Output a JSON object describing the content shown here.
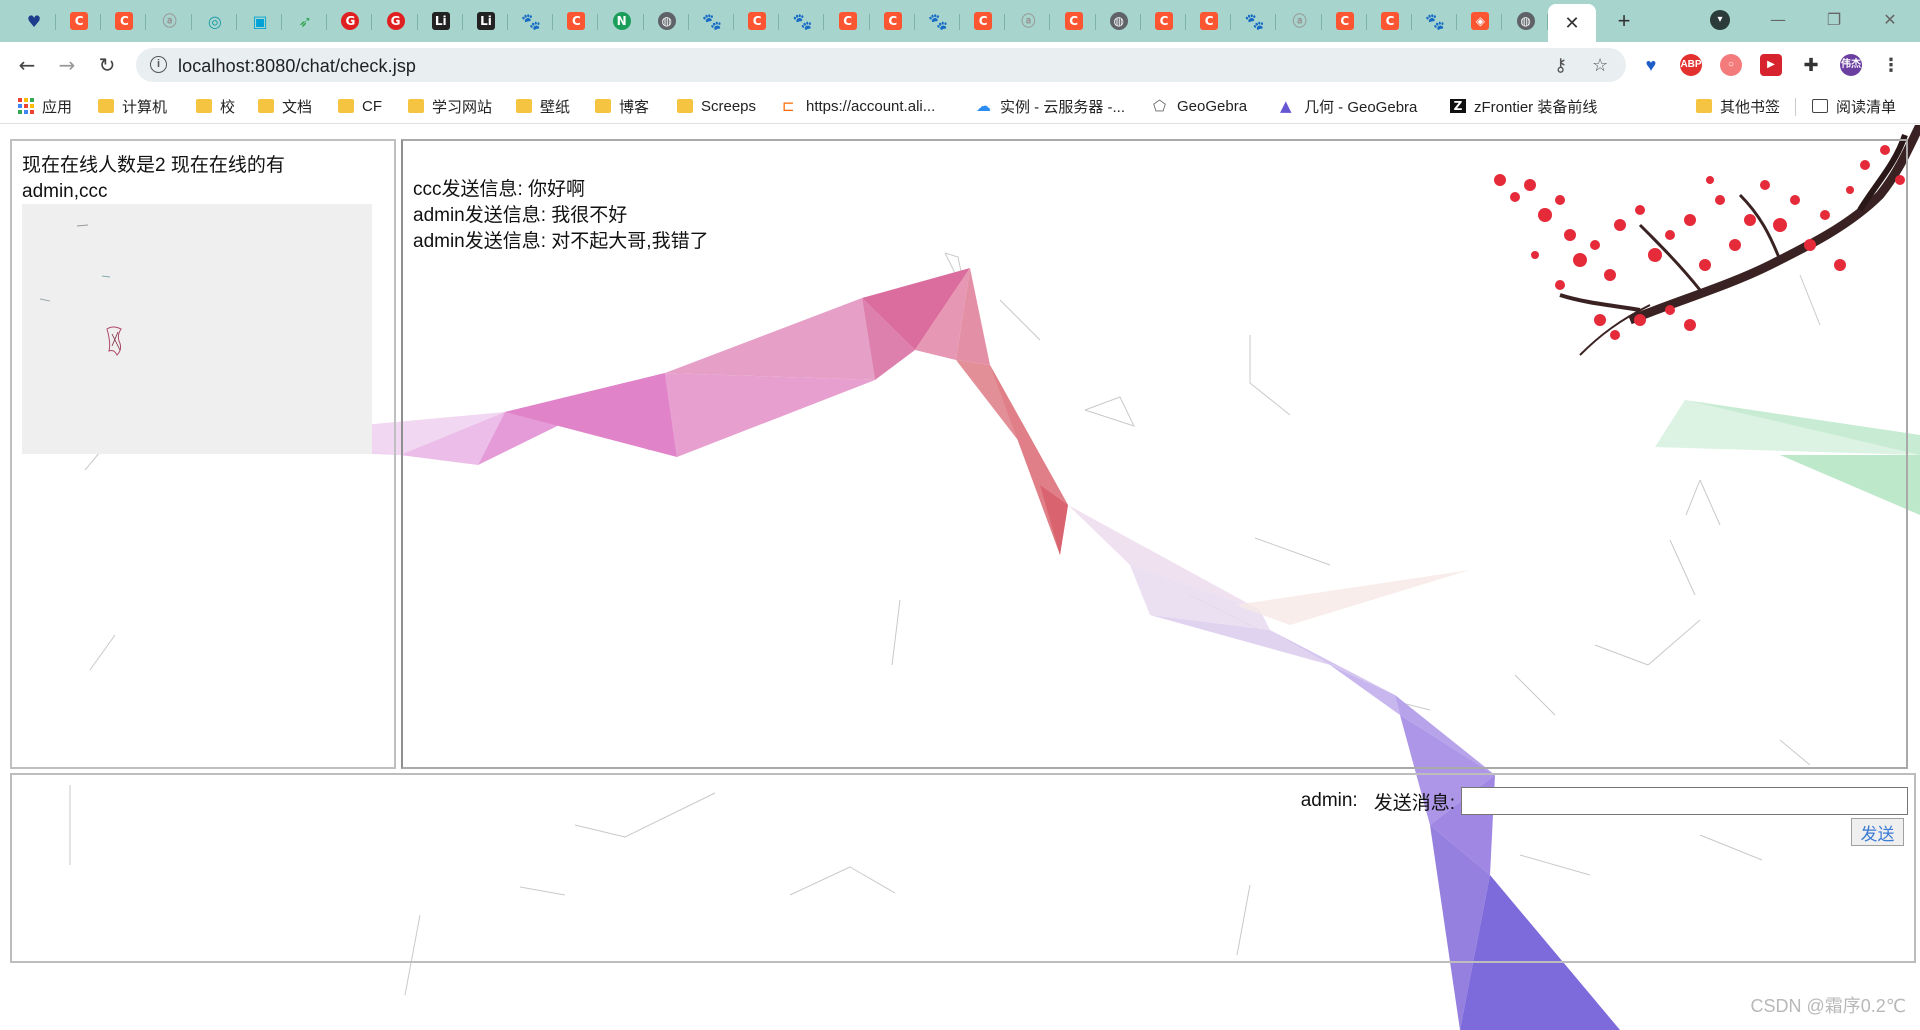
{
  "browser": {
    "tabs": [
      {
        "icon": "vivaldi-icon"
      },
      {
        "icon": "csdn-icon"
      },
      {
        "icon": "csdn-icon"
      },
      {
        "icon": "translate-icon"
      },
      {
        "icon": "green-circle-icon"
      },
      {
        "icon": "bilibili-icon"
      },
      {
        "icon": "leaf-icon"
      },
      {
        "icon": "red-g-icon"
      },
      {
        "icon": "red-g-icon"
      },
      {
        "icon": "li-icon"
      },
      {
        "icon": "li-icon"
      },
      {
        "icon": "baidu-icon"
      },
      {
        "icon": "csdn-icon"
      },
      {
        "icon": "n-icon"
      },
      {
        "icon": "globe-icon"
      },
      {
        "icon": "baidu-icon"
      },
      {
        "icon": "csdn-icon"
      },
      {
        "icon": "baidu-icon"
      },
      {
        "icon": "csdn-icon"
      },
      {
        "icon": "csdn-icon"
      },
      {
        "icon": "baidu-icon"
      },
      {
        "icon": "csdn-icon"
      },
      {
        "icon": "translate-icon"
      },
      {
        "icon": "csdn-icon"
      },
      {
        "icon": "globe-icon"
      },
      {
        "icon": "csdn-icon"
      },
      {
        "icon": "csdn-icon"
      },
      {
        "icon": "baidu-icon"
      },
      {
        "icon": "translate-icon"
      },
      {
        "icon": "csdn-icon"
      },
      {
        "icon": "csdn-icon"
      },
      {
        "icon": "baidu-icon"
      },
      {
        "icon": "shield-icon"
      },
      {
        "icon": "globe-icon"
      }
    ],
    "active_tab_close": "✕",
    "new_tab": "+",
    "url": "localhost:8080/chat/check.jsp",
    "profile_label": "伟杰",
    "bookmarks": [
      {
        "label": "应用",
        "type": "apps"
      },
      {
        "label": "计算机",
        "type": "folder"
      },
      {
        "label": "校",
        "type": "folder"
      },
      {
        "label": "文档",
        "type": "folder"
      },
      {
        "label": "CF",
        "type": "folder"
      },
      {
        "label": "学习网站",
        "type": "folder"
      },
      {
        "label": "壁纸",
        "type": "folder"
      },
      {
        "label": "博客",
        "type": "folder"
      },
      {
        "label": "Screeps",
        "type": "folder"
      },
      {
        "label": "https://account.ali...",
        "type": "aliyun"
      },
      {
        "label": "实例 - 云服务器 -...",
        "type": "cloud"
      },
      {
        "label": "GeoGebra",
        "type": "geogebra"
      },
      {
        "label": "几何 - GeoGebra",
        "type": "geogebra-geometry"
      },
      {
        "label": "zFrontier 装备前线",
        "type": "zfrontier"
      }
    ],
    "other_bookmarks": "其他书签",
    "reading_list": "阅读清单",
    "colors": {
      "tabstrip": "#a7d5cd",
      "csdn": "#fc5531",
      "folder": "#f5c542"
    }
  },
  "chat": {
    "online_status": "现在在线人数是2 现在在线的有admin,ccc",
    "messages": [
      "ccc发送信息: 你好啊",
      "admin发送信息: 我很不好",
      "admin发送信息: 对不起大哥,我错了"
    ],
    "current_user": "admin:",
    "send_label": "发送消息:",
    "send_input_value": "",
    "send_button": "发送"
  },
  "watermark": "CSDN @霜序0.2℃"
}
